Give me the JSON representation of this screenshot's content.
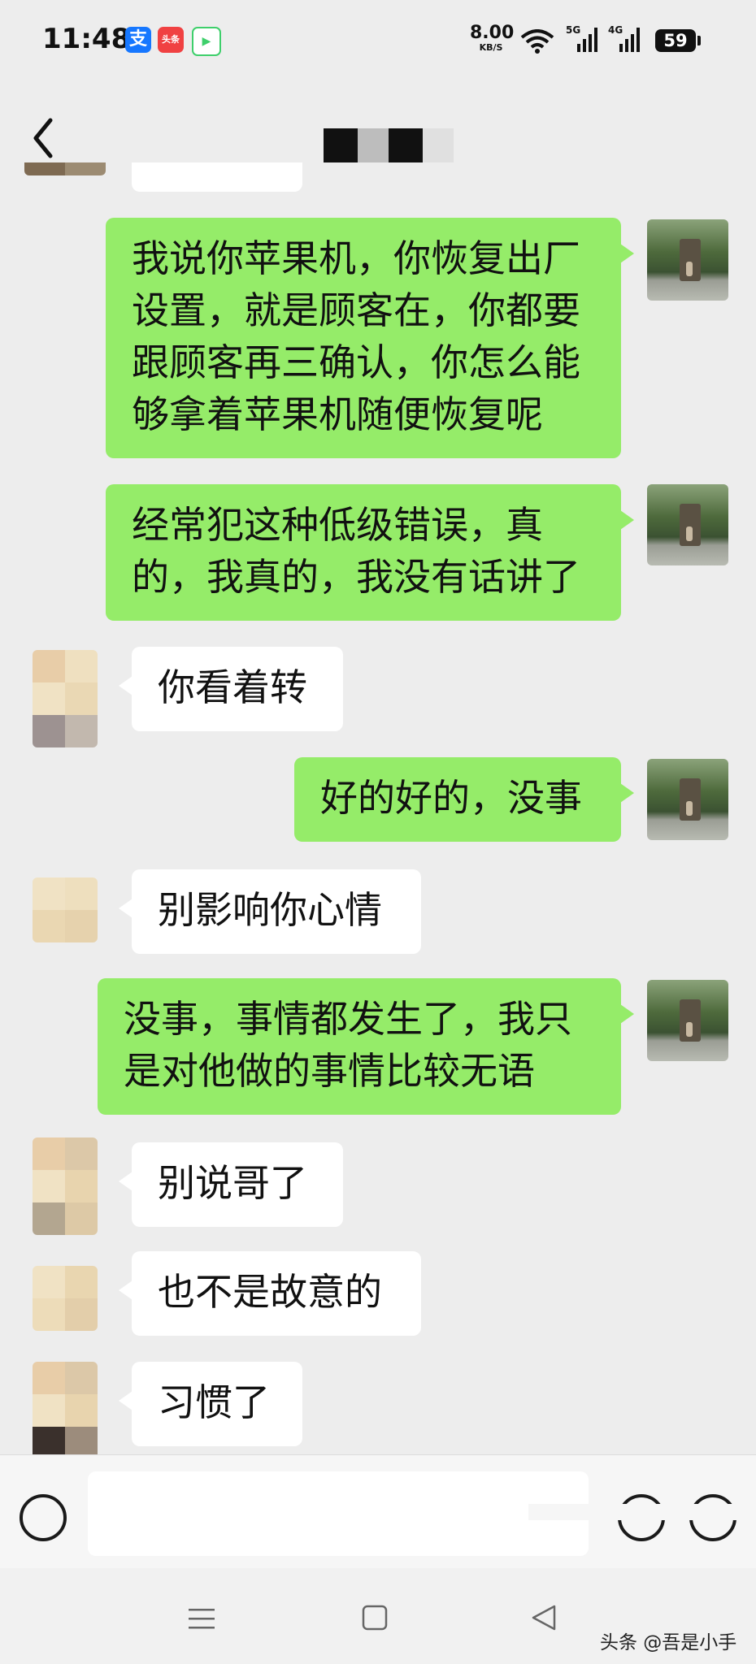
{
  "status_bar": {
    "time": "11:48",
    "icons": [
      "alipay-icon",
      "toutiao-icon",
      "video-app-icon"
    ],
    "net_speed": "8.00",
    "net_speed_unit": "KB/S",
    "sim1": "5G",
    "sim2": "4G",
    "battery": "59"
  },
  "nav": {
    "back_icon": "chevron-left-icon",
    "title_redacted": true
  },
  "messages": [
    {
      "side": "sent",
      "lines": [
        "我说你苹果机，你恢复出厂",
        "设置，就是顾客在，你都要",
        "跟顾客再三确认，你怎么能",
        "够拿着苹果机随便恢复呢"
      ]
    },
    {
      "side": "sent",
      "lines": [
        "经常犯这种低级错误，真",
        "的，我真的，我没有话讲了"
      ]
    },
    {
      "side": "received",
      "lines": [
        "你看着转"
      ]
    },
    {
      "side": "sent",
      "lines": [
        "好的好的，没事"
      ]
    },
    {
      "side": "received",
      "lines": [
        "别影响你心情"
      ]
    },
    {
      "side": "sent",
      "lines": [
        "没事，事情都发生了，我只",
        "是对他做的事情比较无语"
      ]
    },
    {
      "side": "received",
      "lines": [
        "别说哥了"
      ]
    },
    {
      "side": "received",
      "lines": [
        "也不是故意的"
      ]
    },
    {
      "side": "received",
      "lines": [
        "习惯了"
      ]
    }
  ],
  "input_bar": {
    "voice_icon": "voice-icon",
    "emoji_icon": "emoji-icon",
    "plus_icon": "plus-icon",
    "text": ""
  },
  "system_nav": {
    "icons": [
      "menu-icon",
      "home-icon",
      "back-triangle-icon"
    ]
  },
  "watermark": "头条 @吾是小手",
  "colors": {
    "background": "#ededed",
    "sent_bubble": "#95ec69",
    "received_bubble": "#ffffff"
  }
}
